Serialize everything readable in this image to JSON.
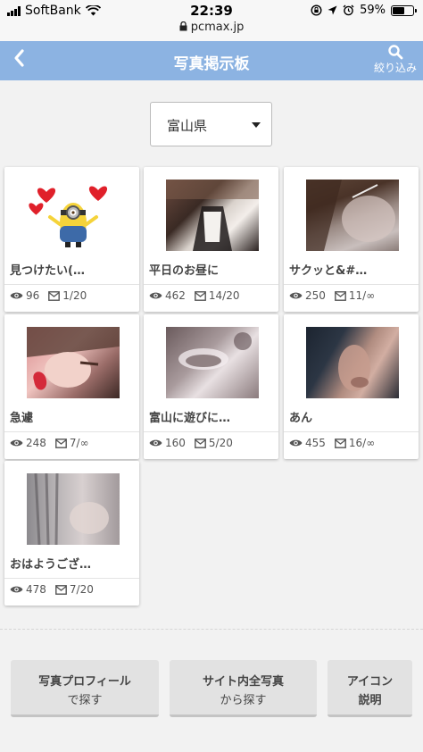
{
  "status_bar": {
    "carrier": "SoftBank",
    "time": "22:39",
    "url": "pcmax.jp",
    "battery": "59%",
    "battery_level": 0.59
  },
  "header": {
    "title": "写真掲示板",
    "filter_label": "絞り込み"
  },
  "filter": {
    "selected": "富山県"
  },
  "posts": [
    {
      "title": "見つけたい(…",
      "views": "96",
      "messages": "1/20"
    },
    {
      "title": "平日のお昼に",
      "views": "462",
      "messages": "14/20"
    },
    {
      "title": "サクッと&#…",
      "views": "250",
      "messages": "11/∞"
    },
    {
      "title": "急遽",
      "views": "248",
      "messages": "7/∞"
    },
    {
      "title": "富山に遊びに…",
      "views": "160",
      "messages": "5/20"
    },
    {
      "title": "あん",
      "views": "455",
      "messages": "16/∞"
    },
    {
      "title": "おはようござ…",
      "views": "478",
      "messages": "7/20"
    }
  ],
  "buttons": {
    "photo_profile": {
      "line1": "写真プロフィール",
      "line2": "で探す"
    },
    "all_photos": {
      "line1": "サイト内全写真",
      "line2": "から探す"
    },
    "icon_help": {
      "line1": "アイコン",
      "line2": "説明"
    }
  }
}
